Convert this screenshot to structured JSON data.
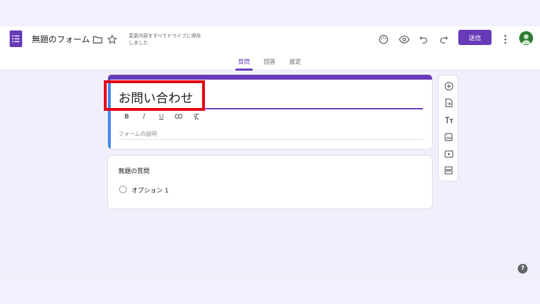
{
  "header": {
    "doc_title": "無題のフォーム",
    "save_status": "変更内容をすべてドライブに保存しました",
    "send_label": "送信",
    "icons": [
      "folder-icon",
      "star-icon",
      "palette-icon",
      "eye-icon",
      "undo-icon",
      "redo-icon",
      "more-vert-icon"
    ]
  },
  "tabs": [
    {
      "label": "質問",
      "active": true
    },
    {
      "label": "回答",
      "active": false
    },
    {
      "label": "設定",
      "active": false
    }
  ],
  "form": {
    "title": "お問い合わせ",
    "description_placeholder": "フォームの説明",
    "format_buttons": [
      "B",
      "I",
      "U"
    ]
  },
  "question": {
    "title": "無題の質問",
    "option_label": "オプション 1"
  },
  "toolbar": [
    "add-question-icon",
    "import-questions-icon",
    "add-title-icon",
    "add-image-icon",
    "add-video-icon",
    "add-section-icon"
  ],
  "help_label": "?",
  "colors": {
    "accent": "#673ab7",
    "highlight": "#e60012",
    "background": "#f0effb"
  }
}
